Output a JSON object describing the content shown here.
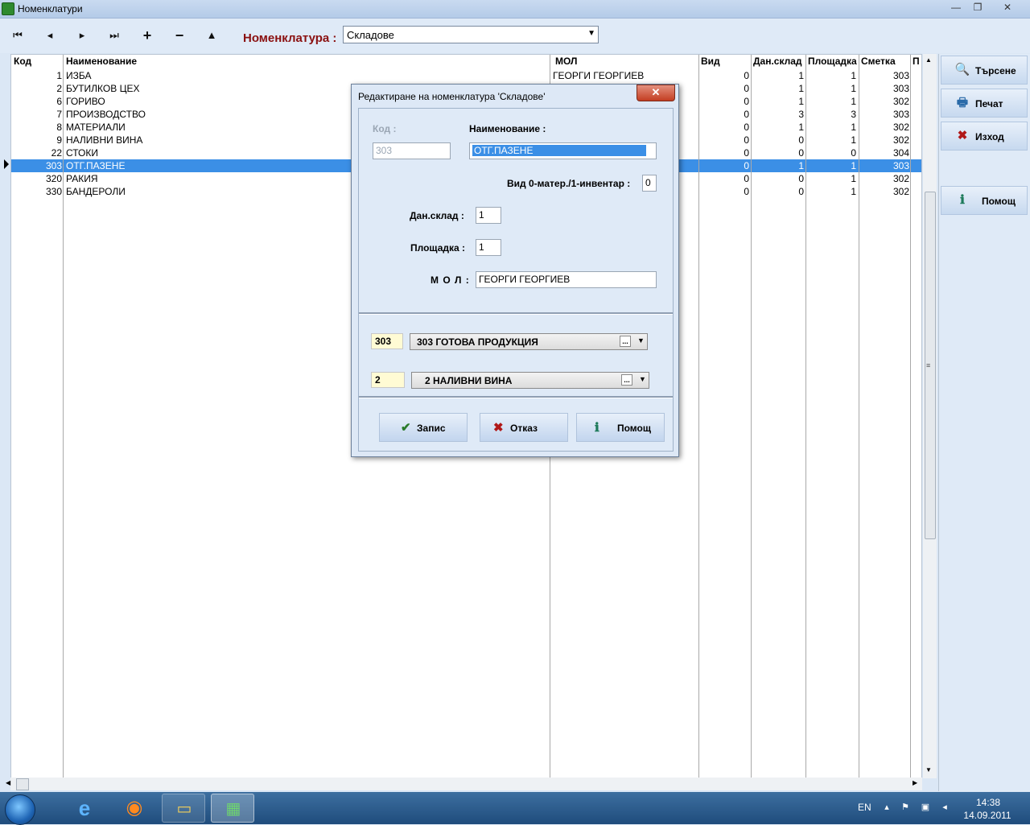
{
  "window": {
    "title": "Номенклатури",
    "controls": {
      "minimize": "—",
      "maximize": "❐",
      "close": "✕"
    }
  },
  "toolbar": {
    "nav": [
      {
        "name": "first-record-button",
        "glyph": "⏮"
      },
      {
        "name": "prev-record-button",
        "glyph": "◂"
      },
      {
        "name": "next-record-button",
        "glyph": "▸"
      },
      {
        "name": "last-record-button",
        "glyph": "⏭"
      },
      {
        "name": "add-record-button",
        "glyph": "+"
      },
      {
        "name": "delete-record-button",
        "glyph": "−"
      },
      {
        "name": "move-up-button",
        "glyph": "▲"
      }
    ],
    "nomenclature_label": "Номенклатура :",
    "nomenclature_value": "Складове"
  },
  "grid": {
    "columns": [
      "Код",
      "Наименование",
      "МОЛ",
      "Вид",
      "Дан.склад",
      "Площадка",
      "Сметка",
      "П"
    ],
    "rows": [
      {
        "kod": "1",
        "name": "ИЗБА",
        "mol": "ГЕОРГИ ГЕОРГИЕВ",
        "vid": "0",
        "dan": "1",
        "plosht": "1",
        "smetka": "303"
      },
      {
        "kod": "2",
        "name": "БУТИЛКОВ ЦЕХ",
        "mol": "",
        "vid": "0",
        "dan": "1",
        "plosht": "1",
        "smetka": "303"
      },
      {
        "kod": "6",
        "name": "ГОРИВО",
        "mol": "",
        "vid": "0",
        "dan": "1",
        "plosht": "1",
        "smetka": "302"
      },
      {
        "kod": "7",
        "name": "ПРОИЗВОДСТВО",
        "mol": "",
        "vid": "0",
        "dan": "3",
        "plosht": "3",
        "smetka": "303"
      },
      {
        "kod": "8",
        "name": "МАТЕРИАЛИ",
        "mol": "",
        "vid": "0",
        "dan": "1",
        "plosht": "1",
        "smetka": "302"
      },
      {
        "kod": "9",
        "name": "НАЛИВНИ ВИНА",
        "mol": "",
        "vid": "0",
        "dan": "0",
        "plosht": "1",
        "smetka": "302"
      },
      {
        "kod": "22",
        "name": "СТОКИ",
        "mol": "",
        "vid": "0",
        "dan": "0",
        "plosht": "0",
        "smetka": "304"
      },
      {
        "kod": "303",
        "name": "ОТГ.ПАЗЕНЕ",
        "mol": "",
        "vid": "0",
        "dan": "1",
        "plosht": "1",
        "smetka": "303"
      },
      {
        "kod": "320",
        "name": "РАКИЯ",
        "mol": "",
        "vid": "0",
        "dan": "0",
        "plosht": "1",
        "smetka": "302"
      },
      {
        "kod": "330",
        "name": "БАНДЕРОЛИ",
        "mol": "",
        "vid": "0",
        "dan": "0",
        "plosht": "1",
        "smetka": "302"
      }
    ],
    "selected_index": 7
  },
  "sidebar": {
    "buttons": [
      {
        "label": "Търсене",
        "icon": "search-icon",
        "glyph": "🔍"
      },
      {
        "label": "Печат",
        "icon": "printer-icon",
        "glyph": "🖶"
      },
      {
        "label": "Изход",
        "icon": "exit-icon",
        "glyph": "✖"
      },
      {
        "label": "Помощ",
        "icon": "help-icon",
        "glyph": "ℹ"
      }
    ]
  },
  "dialog": {
    "title": "Редактиране на номенклатура 'Складове'",
    "close_glyph": "✕",
    "kod_label": "Код :",
    "kod_value": "303",
    "name_label": "Наименование :",
    "name_value": "ОТГ.ПАЗЕНЕ",
    "vid_label": "Вид 0-матер./1-инвентар :",
    "vid_value": "0",
    "dan_label": "Дан.склад :",
    "dan_value": "1",
    "plosht_label": "Площадка :",
    "plosht_value": "1",
    "mol_label": "М О Л :",
    "mol_value": "ГЕОРГИ ГЕОРГИЕВ",
    "account_code": "303",
    "account_text": "303 ГОТОВА ПРОДУКЦИЯ",
    "type_code": "2",
    "type_text": "2 НАЛИВНИ ВИНА",
    "ellipsis": "...",
    "save_label": "Запис",
    "cancel_label": "Отказ",
    "help_label": "Помощ"
  },
  "taskbar": {
    "lang": "EN",
    "time": "14:38",
    "date": "14.09.2011"
  },
  "colors": {
    "selection": "#3b8fe6",
    "label_accent": "#8a1010"
  }
}
